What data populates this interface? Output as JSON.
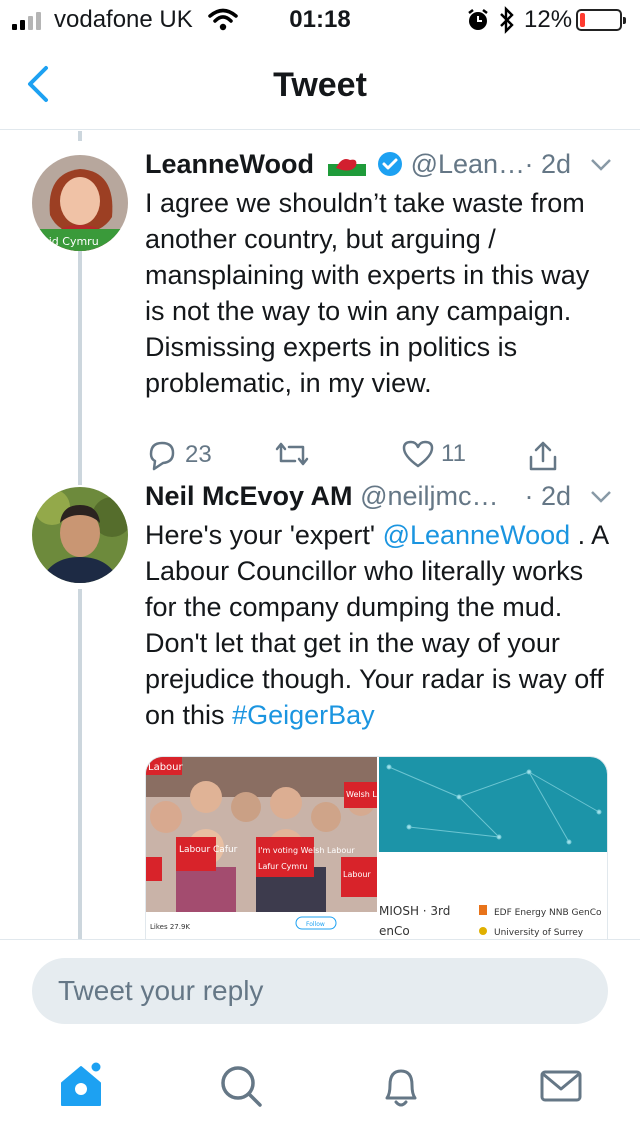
{
  "status_bar": {
    "carrier": "vodafone UK",
    "time": "01:18",
    "battery_percent": "12%",
    "battery_level": 0.12,
    "signal_bars": 2,
    "signal_total": 4
  },
  "nav": {
    "title": "Tweet",
    "back_icon": "chevron-left-icon"
  },
  "tweets": [
    {
      "name": "LeanneWood",
      "flag": "🏴",
      "verified": true,
      "handle": "@Lean…",
      "time": "· 2d",
      "text": "I agree we shouldn’t take waste from another country, but arguing / mansplaining with experts in this way is not the way to win any campaign. Dismissing experts in politics is problematic, in my view.",
      "avatar_caption": "aid Cymru",
      "replies": "23",
      "likes": "11"
    },
    {
      "name": "Neil McEvoy AM",
      "handle": "@neiljmc…",
      "time": "· 2d",
      "text_parts": [
        "Here's your 'expert' ",
        "@LeanneWood",
        " . A Labour Councillor who literally works for the company dumping the mud. Don't let that get in the way of your prejudice though. Your radar is way off on this ",
        "#GeigerBay"
      ]
    }
  ],
  "media": {
    "left_signs": [
      "Labour",
      "Labour Cafur",
      "I'm voting Welsh Labour",
      "Lafur Cymru",
      "Labour",
      "Welsh Lab"
    ],
    "left_stats": "Likes 27.9K",
    "left_follow": "Follow",
    "right_items": [
      "MIOSH · 3rd",
      "EDF Energy NNB GenCo",
      "enCo",
      "University of Surrey"
    ]
  },
  "reply": {
    "placeholder": "Tweet your reply"
  },
  "tabs": [
    "home-icon",
    "search-icon",
    "notifications-bell-icon",
    "messages-envelope-icon"
  ],
  "colors": {
    "accent": "#1da1f2",
    "link": "#1b95e0",
    "muted": "#657786",
    "battery_low": "#ff3b30"
  }
}
